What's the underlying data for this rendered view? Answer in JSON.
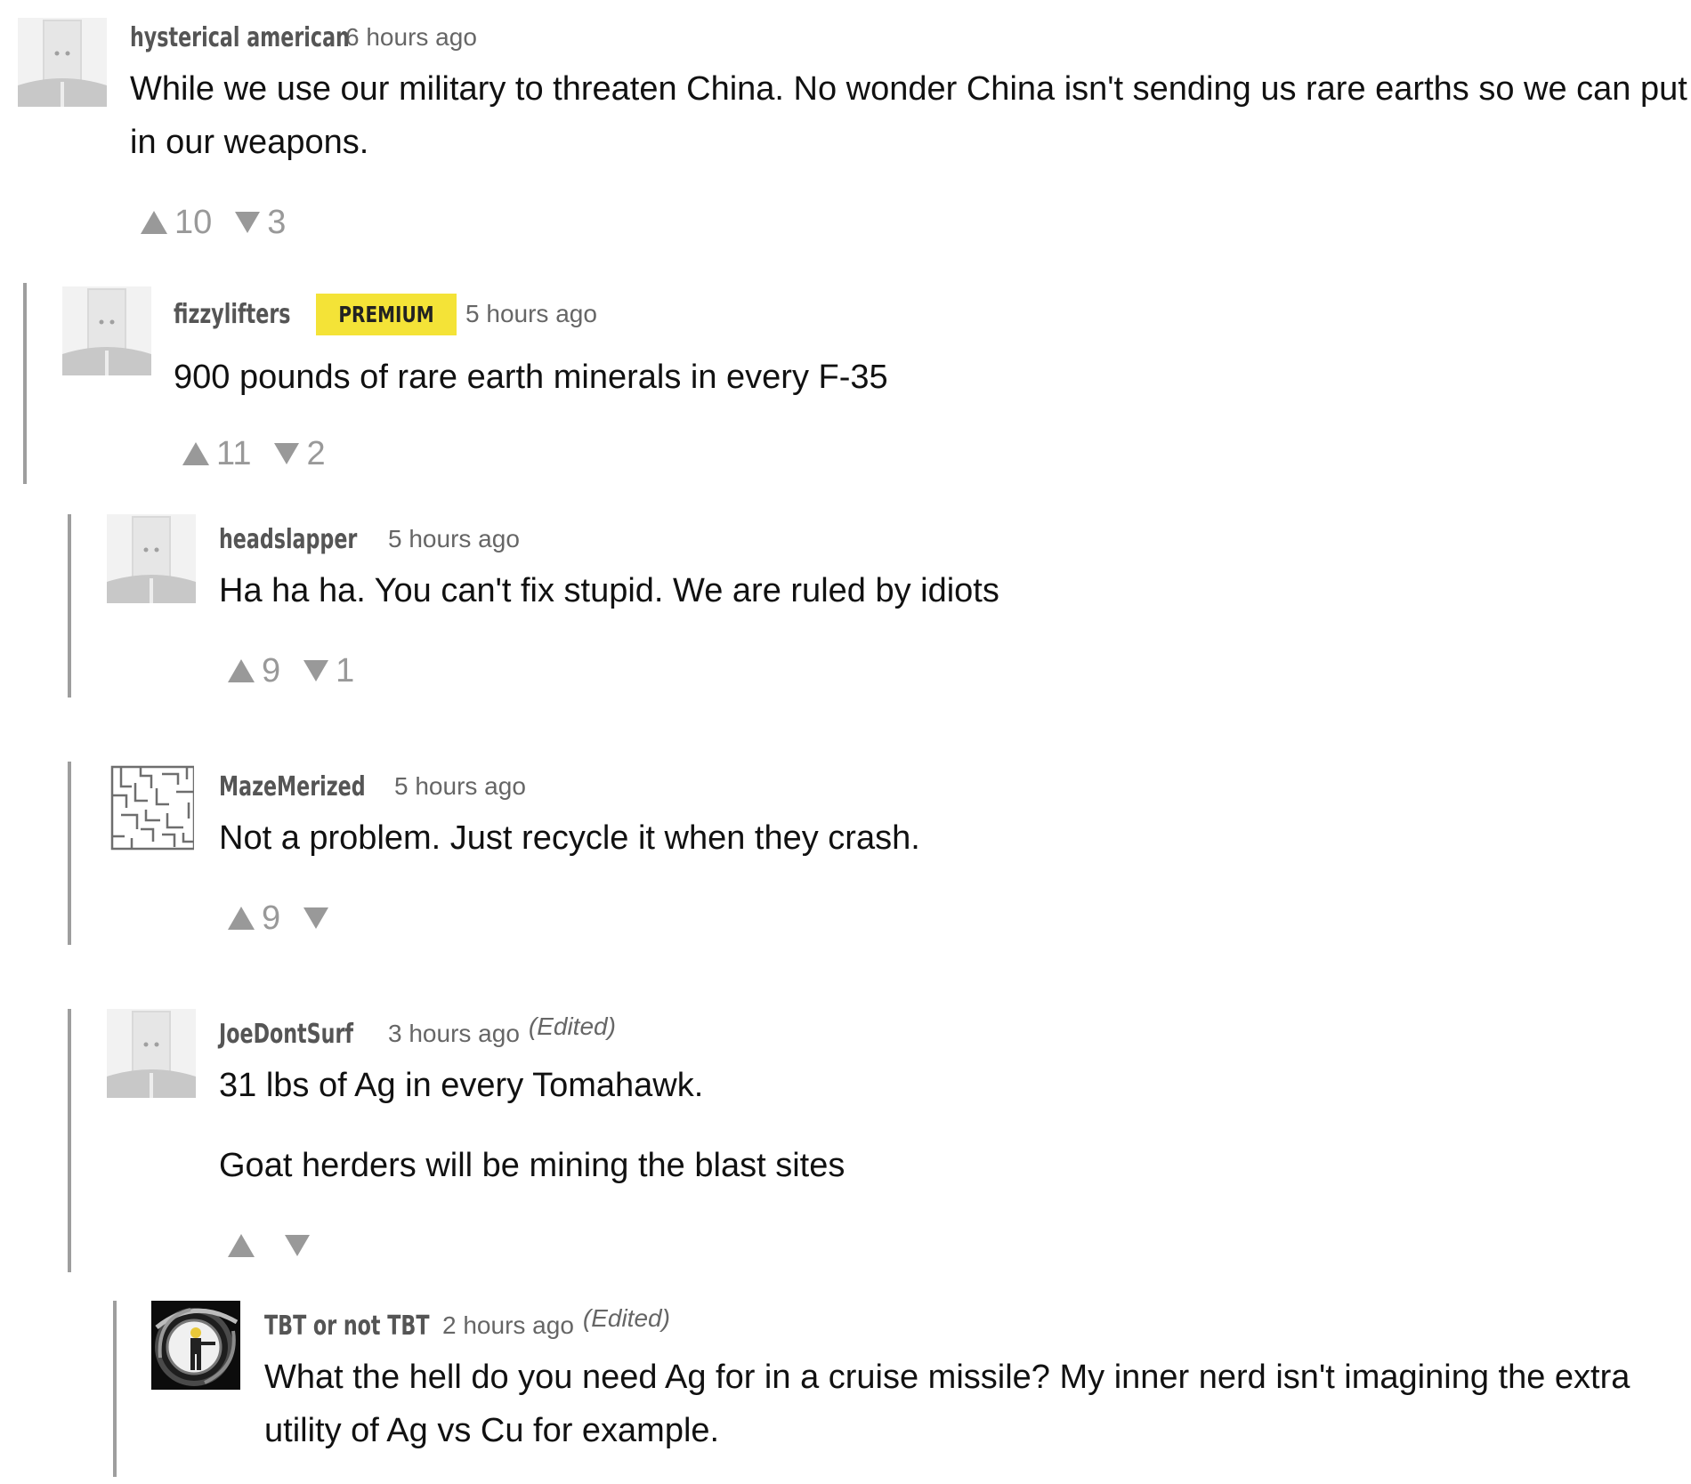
{
  "comments": [
    {
      "author": "hysterical american",
      "badge": "",
      "time": "6 hours ago",
      "edited": "",
      "avatar": "paper-bag-avatar",
      "paragraphs": [
        "While we use our military to threaten China.  No wonder China isn't sending us rare earths so we can put in our weapons."
      ],
      "upvotes": "10",
      "downvotes": "3"
    },
    {
      "author": "fizzylifters",
      "badge": "PREMIUM",
      "time": "5 hours ago",
      "edited": "",
      "avatar": "paper-bag-avatar",
      "paragraphs": [
        "900 pounds of rare earth minerals in every F-35"
      ],
      "upvotes": "11",
      "downvotes": "2"
    },
    {
      "author": "headslapper",
      "badge": "",
      "time": "5 hours ago",
      "edited": "",
      "avatar": "paper-bag-avatar",
      "paragraphs": [
        "Ha ha ha. You can't fix stupid. We are ruled by idiots"
      ],
      "upvotes": "9",
      "downvotes": "1"
    },
    {
      "author": "MazeMerized",
      "badge": "",
      "time": "5 hours ago",
      "edited": "",
      "avatar": "maze-avatar",
      "paragraphs": [
        "Not a problem.  Just recycle it when they crash."
      ],
      "upvotes": "9",
      "downvotes": ""
    },
    {
      "author": "JoeDontSurf",
      "badge": "",
      "time": "3 hours ago",
      "edited": "(Edited)",
      "avatar": "paper-bag-avatar",
      "paragraphs": [
        "31 lbs of Ag in every Tomahawk.",
        "Goat herders will be mining the blast sites"
      ],
      "upvotes": "",
      "downvotes": ""
    },
    {
      "author": "TBT or not TBT",
      "badge": "",
      "time": "2 hours ago",
      "edited": "(Edited)",
      "avatar": "gun-barrel-avatar",
      "paragraphs": [
        "What the hell do you need Ag for in a cruise missile?   My inner nerd isn't imagining the extra utility of Ag vs Cu for example."
      ],
      "upvotes": "",
      "downvotes": ""
    }
  ],
  "colors": {
    "premium_badge": "#f4e337",
    "thread_bar": "#9e9e9e",
    "meta_text": "#666666",
    "vote_arrows": "#999999"
  },
  "icons": {
    "upvote": "triangle-up",
    "downvote": "triangle-down"
  }
}
